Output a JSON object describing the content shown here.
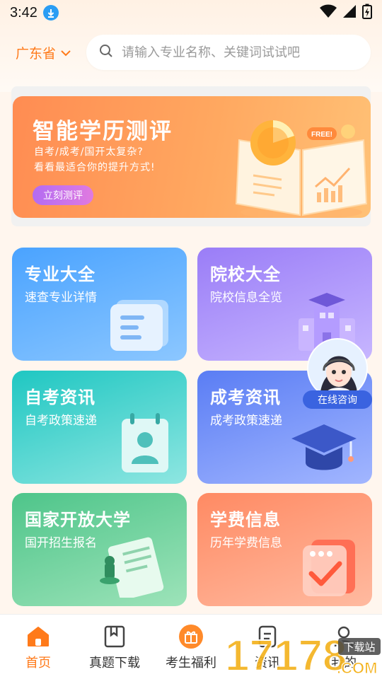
{
  "status": {
    "time": "3:42"
  },
  "header": {
    "province": "广东省",
    "search_placeholder": "请输入专业名称、关键词试试吧"
  },
  "banner": {
    "title": "智能学历测评",
    "line1": "自考/成考/国开太复杂?",
    "line2": "看看最适合你的提升方式!",
    "button": "立刻测评",
    "badge": "FREE!"
  },
  "cards": [
    {
      "title": "专业大全",
      "subtitle": "速查专业详情"
    },
    {
      "title": "院校大全",
      "subtitle": "院校信息全览"
    },
    {
      "title": "自考资讯",
      "subtitle": "自考政策速递"
    },
    {
      "title": "成考资讯",
      "subtitle": "成考政策速递"
    },
    {
      "title": "国家开放大学",
      "subtitle": "国开招生报名"
    },
    {
      "title": "学费信息",
      "subtitle": "历年学费信息"
    }
  ],
  "consult": {
    "label": "在线咨询"
  },
  "tabs": [
    {
      "label": "首页",
      "icon": "home-icon"
    },
    {
      "label": "真题下载",
      "icon": "book-icon"
    },
    {
      "label": "考生福利",
      "icon": "gift-icon"
    },
    {
      "label": "资讯",
      "icon": "news-icon"
    },
    {
      "label": "我的",
      "icon": "user-icon"
    }
  ],
  "watermark": {
    "text": "17178",
    "tag": "下载站",
    "suffix": ".COM"
  },
  "colors": {
    "accent": "#ff7a1a",
    "banner": "#ff9a5a"
  }
}
